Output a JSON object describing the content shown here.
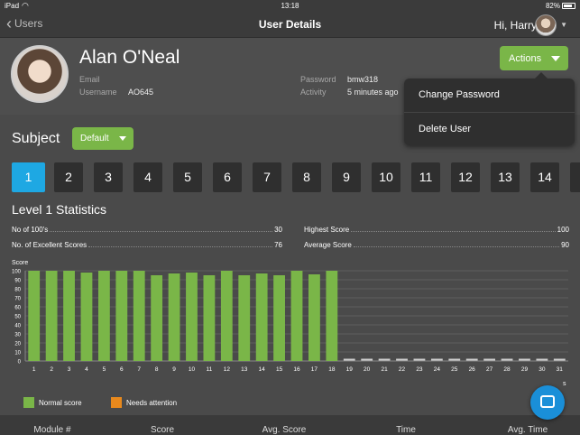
{
  "status_bar": {
    "carrier": "iPad",
    "wifi_icon": "wifi-icon",
    "time": "13:18",
    "battery": "82%",
    "battery_level": 0.82
  },
  "nav": {
    "back_label": "Users",
    "title": "User Details",
    "greeting": "Hi, Harry"
  },
  "profile": {
    "name": "Alan O'Neal",
    "email_label": "Email",
    "email_value": "",
    "username_label": "Username",
    "username_value": "AO645",
    "password_label": "Password",
    "password_value": "bmw318",
    "activity_label": "Activity",
    "activity_value": "5 minutes ago"
  },
  "actions": {
    "button_label": "Actions",
    "menu": [
      {
        "label": "Change Password"
      },
      {
        "label": "Delete User"
      }
    ]
  },
  "subject": {
    "label": "Subject",
    "selected": "Default"
  },
  "levels": [
    {
      "label": "1",
      "active": true
    },
    {
      "label": "2"
    },
    {
      "label": "3"
    },
    {
      "label": "4"
    },
    {
      "label": "5"
    },
    {
      "label": "6"
    },
    {
      "label": "7"
    },
    {
      "label": "8"
    },
    {
      "label": "9"
    },
    {
      "label": "10"
    },
    {
      "label": "11"
    },
    {
      "label": "12"
    },
    {
      "label": "13"
    },
    {
      "label": "14"
    },
    {
      "label": ""
    }
  ],
  "stats": {
    "title": "Level 1 Statistics",
    "no_of_100s_label": "No of 100's",
    "no_of_100s_value": "30",
    "excellent_label": "No. of Excellent Scores",
    "excellent_value": "76",
    "highest_label": "Highest Score",
    "highest_value": "100",
    "average_label": "Average Score",
    "average_value": "90"
  },
  "chart_data": {
    "type": "bar",
    "ylabel": "Score",
    "ylim": [
      0,
      100
    ],
    "yticks": [
      0,
      10,
      20,
      30,
      40,
      50,
      60,
      70,
      80,
      90,
      100
    ],
    "grid": true,
    "categories": [
      "1",
      "2",
      "3",
      "4",
      "5",
      "6",
      "7",
      "8",
      "9",
      "10",
      "11",
      "12",
      "13",
      "14",
      "15",
      "16",
      "17",
      "18",
      "19",
      "20",
      "21",
      "22",
      "23",
      "24",
      "25",
      "26",
      "27",
      "28",
      "29",
      "30",
      "31"
    ],
    "series": [
      {
        "name": "Normal score",
        "color": "#7ab648",
        "values": [
          100,
          100,
          100,
          98,
          100,
          100,
          100,
          95,
          97,
          98,
          95,
          100,
          95,
          97,
          95,
          100,
          96,
          100,
          0,
          0,
          0,
          0,
          0,
          0,
          0,
          0,
          0,
          0,
          0,
          0,
          0
        ]
      },
      {
        "name": "Needs attention",
        "color": "#e8891d",
        "values": [
          0,
          0,
          0,
          0,
          0,
          0,
          0,
          0,
          0,
          0,
          0,
          0,
          0,
          0,
          0,
          0,
          0,
          0,
          0,
          0,
          0,
          0,
          0,
          0,
          0,
          0,
          0,
          0,
          0,
          0,
          0
        ]
      }
    ],
    "legend_position": "bottom-left",
    "trailing_label": "s"
  },
  "table": {
    "headers": [
      "Module #",
      "Score",
      "Avg. Score",
      "Time",
      "Avg. Time"
    ]
  }
}
